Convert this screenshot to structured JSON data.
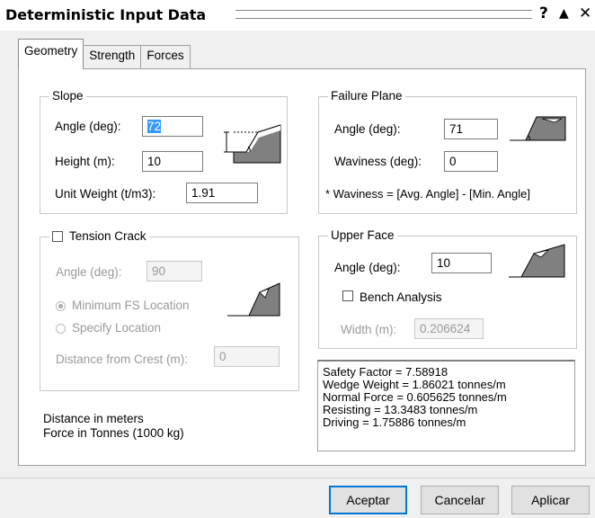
{
  "title": "Deterministic Input Data",
  "titlebar": {
    "help": "?",
    "collapse": "▲",
    "close": "✕"
  },
  "tabs": [
    "Geometry",
    "Strength",
    "Forces"
  ],
  "slope": {
    "legend": "Slope",
    "angle_label": "Angle (deg):",
    "angle_value": "72",
    "height_label": "Height (m):",
    "height_value": "10",
    "unit_weight_label": "Unit Weight (t/m3):",
    "unit_weight_value": "1.91"
  },
  "failure_plane": {
    "legend": "Failure Plane",
    "angle_label": "Angle (deg):",
    "angle_value": "71",
    "waviness_label": "Waviness (deg):",
    "waviness_value": "0",
    "note": "* Waviness = [Avg. Angle] - [Min. Angle]"
  },
  "tension_crack": {
    "legend": "Tension Crack",
    "angle_label": "Angle (deg):",
    "angle_value": "90",
    "min_fs_label": "Minimum FS Location",
    "specify_label": "Specify Location",
    "distance_label": "Distance from Crest (m):",
    "distance_value": "0"
  },
  "upper_face": {
    "legend": "Upper Face",
    "angle_label": "Angle (deg):",
    "angle_value": "10",
    "bench_label": "Bench Analysis",
    "width_label": "Width (m):",
    "width_value": "0.206624"
  },
  "units": {
    "distance": "Distance in meters",
    "force": "Force in Tonnes (1000 kg)"
  },
  "results": [
    "Safety Factor = 7.58918",
    "Wedge Weight = 1.86021 tonnes/m",
    "Normal Force = 0.605625 tonnes/m",
    "Resisting = 13.3483 tonnes/m",
    "Driving = 1.75886 tonnes/m"
  ],
  "buttons": {
    "accept": "Aceptar",
    "cancel": "Cancelar",
    "apply": "Aplicar"
  },
  "icons": [
    "help-icon",
    "collapse-icon",
    "close-icon",
    "slope-diagram-icon",
    "failure-plane-diagram-icon",
    "tension-crack-diagram-icon",
    "upper-face-diagram-icon"
  ],
  "colors": {
    "selection": "#3399ff",
    "disabled_text": "#9a9a9a",
    "default_button_border": "#0078d7"
  }
}
